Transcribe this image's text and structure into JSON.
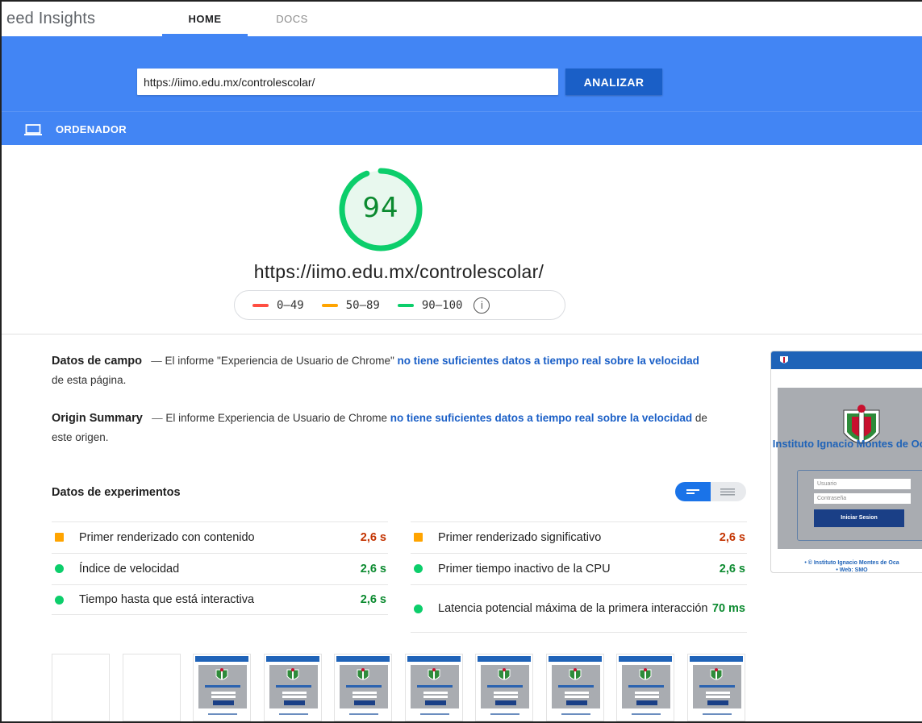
{
  "header": {
    "brand": "eed Insights",
    "tabs": [
      {
        "label": "HOME",
        "active": true
      },
      {
        "label": "DOCS",
        "active": false
      }
    ]
  },
  "search": {
    "url_value": "https://iimo.edu.mx/controlescolar/",
    "analyze_label": "ANALIZAR"
  },
  "device": {
    "label": "ORDENADOR",
    "icon": "laptop-icon"
  },
  "score": {
    "value": "94",
    "fraction": 0.94,
    "url": "https://iimo.edu.mx/controlescolar/",
    "legend": [
      {
        "range": "0–49",
        "color": "#ff4e42"
      },
      {
        "range": "50–89",
        "color": "#ffa400"
      },
      {
        "range": "90–100",
        "color": "#0cce6b"
      }
    ],
    "info_icon": "info-icon"
  },
  "field_data": {
    "title": "Datos de campo",
    "dash": "—",
    "text_before": "El informe \"Experiencia de Usuario de Chrome\" ",
    "link": "no tiene suficientes datos a tiempo real sobre la velocidad",
    "text_after": " de esta página."
  },
  "origin_summary": {
    "title": "Origin Summary",
    "dash": "—",
    "text_before": "El informe Experiencia de Usuario de Chrome ",
    "link": "no tiene suficientes datos a tiempo real sobre la velocidad",
    "text_after": " de este origen."
  },
  "lab_data": {
    "title": "Datos de experimentos",
    "metrics": [
      {
        "label": "Primer renderizado con contenido",
        "value": "2,6 s",
        "status": "average"
      },
      {
        "label": "Primer renderizado significativo",
        "value": "2,6 s",
        "status": "average"
      },
      {
        "label": "Índice de velocidad",
        "value": "2,6 s",
        "status": "good"
      },
      {
        "label": "Primer tiempo inactivo de la CPU",
        "value": "2,6 s",
        "status": "good"
      },
      {
        "label": "Tiempo hasta que está interactiva",
        "value": "2,6 s",
        "status": "good"
      },
      {
        "label": "Latencia potencial máxima de la primera interacción",
        "value": "70 ms",
        "status": "good"
      }
    ]
  },
  "preview": {
    "title": "Instituto Ignacio Montes de Oca",
    "user_placeholder": "Usuario",
    "password_placeholder": "Contraseña",
    "button_label": "Iniciar Sesion",
    "footer_line1": "• © Instituto Ignacio Montes de Oca",
    "footer_line2": "• Web: SMO"
  },
  "filmstrip": {
    "frame_count": 10,
    "blank_frames": 2
  },
  "colors": {
    "brand_blue": "#4285f4",
    "button_blue": "#1a5fc7",
    "good": "#0cce6b",
    "good_text": "#0b8a2f",
    "average": "#ffa400",
    "average_text": "#c33300",
    "poor": "#ff4e42"
  }
}
